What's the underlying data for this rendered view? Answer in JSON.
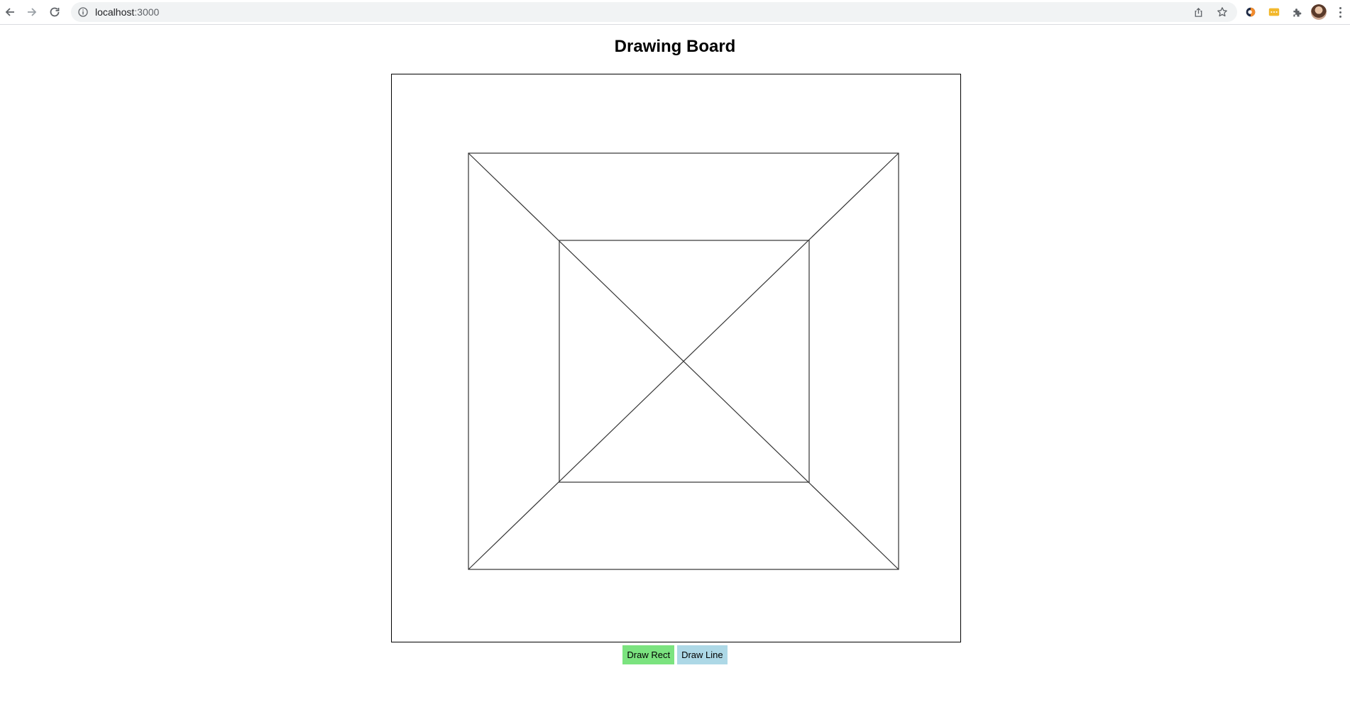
{
  "browser": {
    "url_host": "localhost",
    "url_port": ":3000",
    "icons": {
      "back": "back-arrow-icon",
      "forward": "forward-arrow-icon",
      "reload": "reload-icon",
      "info": "info-icon",
      "share": "share-icon",
      "bookmark": "star-icon",
      "extension_1": "extension-icon",
      "extension_2": "extension-icon",
      "extensions": "puzzle-icon",
      "profile": "avatar",
      "menu": "more-vert-icon"
    }
  },
  "page": {
    "title": "Drawing Board"
  },
  "buttons": {
    "draw_rect": {
      "label": "Draw Rect",
      "color": "#7be37f"
    },
    "draw_line": {
      "label": "Draw Line",
      "color": "#add8e6"
    }
  },
  "colors": {
    "stroke": "#000000",
    "background": "#ffffff"
  }
}
